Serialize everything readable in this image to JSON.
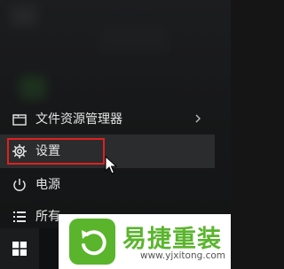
{
  "start_menu": {
    "items": [
      {
        "label": "文件资源管理器",
        "icon": "folder-icon",
        "has_submenu": true
      },
      {
        "label": "设置",
        "icon": "gear-icon",
        "highlighted": true
      },
      {
        "label": "电源",
        "icon": "power-icon"
      },
      {
        "label": "所有",
        "icon": "list-icon"
      }
    ]
  },
  "taskbar": {
    "start_icon": "windows-logo-icon"
  },
  "watermark": {
    "name": "易捷重装",
    "url": "www.yjxitong.com"
  },
  "colors": {
    "highlight_border": "#e0201f",
    "brand_green": "#5ab52d"
  }
}
